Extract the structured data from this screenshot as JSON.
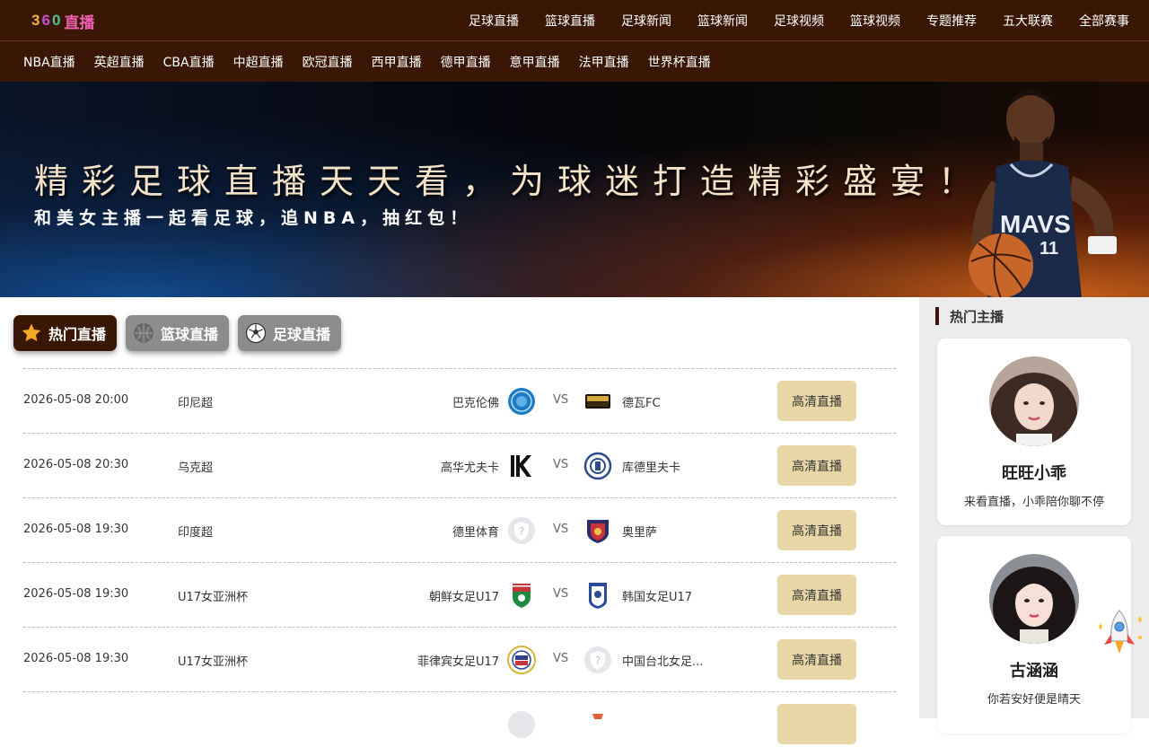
{
  "header": {
    "logo_digits": [
      "3",
      "6",
      "0"
    ],
    "logo_text": "直播",
    "nav": [
      "足球直播",
      "篮球直播",
      "足球新闻",
      "篮球新闻",
      "足球视频",
      "篮球视频",
      "专题推荐",
      "五大联赛",
      "全部赛事"
    ]
  },
  "subnav": [
    "NBA直播",
    "英超直播",
    "CBA直播",
    "中超直播",
    "欧冠直播",
    "西甲直播",
    "德甲直播",
    "意甲直播",
    "法甲直播",
    "世界杯直播"
  ],
  "banner": {
    "title": "精彩足球直播天天看，为球迷打造精彩盛宴！",
    "subtitle": "和美女主播一起看足球，追NBA，抽红包！",
    "jersey_text": "MAVS"
  },
  "tabs": [
    {
      "label": "热门直播",
      "icon": "star-icon",
      "active": true
    },
    {
      "label": "篮球直播",
      "icon": "basketball-icon",
      "active": false
    },
    {
      "label": "足球直播",
      "icon": "soccer-ball-icon",
      "active": false
    }
  ],
  "matches": [
    {
      "time": "2026-05-08 20:00",
      "league": "印尼超",
      "home": "巴克伦佛",
      "vs": "VS",
      "away": "德瓦FC",
      "button": "高清直播",
      "home_logo": "blue-round-crest",
      "away_logo": "dewa-crest"
    },
    {
      "time": "2026-05-08 20:30",
      "league": "乌克超",
      "home": "高华尤夫卡",
      "vs": "VS",
      "away": "库德里夫卡",
      "button": "高清直播",
      "home_logo": "k-crest",
      "away_logo": "kudrivka-crest"
    },
    {
      "time": "2026-05-08 19:30",
      "league": "印度超",
      "home": "德里体育",
      "vs": "VS",
      "away": "奥里萨",
      "button": "高清直播",
      "home_logo": "placeholder-shield",
      "away_logo": "odisha-crest"
    },
    {
      "time": "2026-05-08 19:30",
      "league": "U17女亚洲杯",
      "home": "朝鲜女足U17",
      "vs": "VS",
      "away": "韩国女足U17",
      "button": "高清直播",
      "home_logo": "north-korea-crest",
      "away_logo": "korea-crest"
    },
    {
      "time": "2026-05-08 19:30",
      "league": "U17女亚洲杯",
      "home": "菲律宾女足U17",
      "vs": "VS",
      "away": "中国台北女足...",
      "button": "高清直播",
      "home_logo": "philippines-crest",
      "away_logo": "placeholder-shield"
    },
    {
      "time": "",
      "league": "",
      "home": "",
      "vs": "",
      "away": "",
      "button": "",
      "home_logo": "placeholder-shield",
      "away_logo": "partial-crest"
    }
  ],
  "sidebar": {
    "title": "热门主播",
    "anchors": [
      {
        "name": "旺旺小乖",
        "motto": "来看直播，小乖陪你聊不停"
      },
      {
        "name": "古涵涵",
        "motto": "你若安好便是晴天"
      }
    ]
  },
  "colors": {
    "header_bg": "#3a1705",
    "button_bg": "#e8d6a6",
    "tab_inactive": "#8c8c8c",
    "sidebar_bg": "#ececec"
  }
}
